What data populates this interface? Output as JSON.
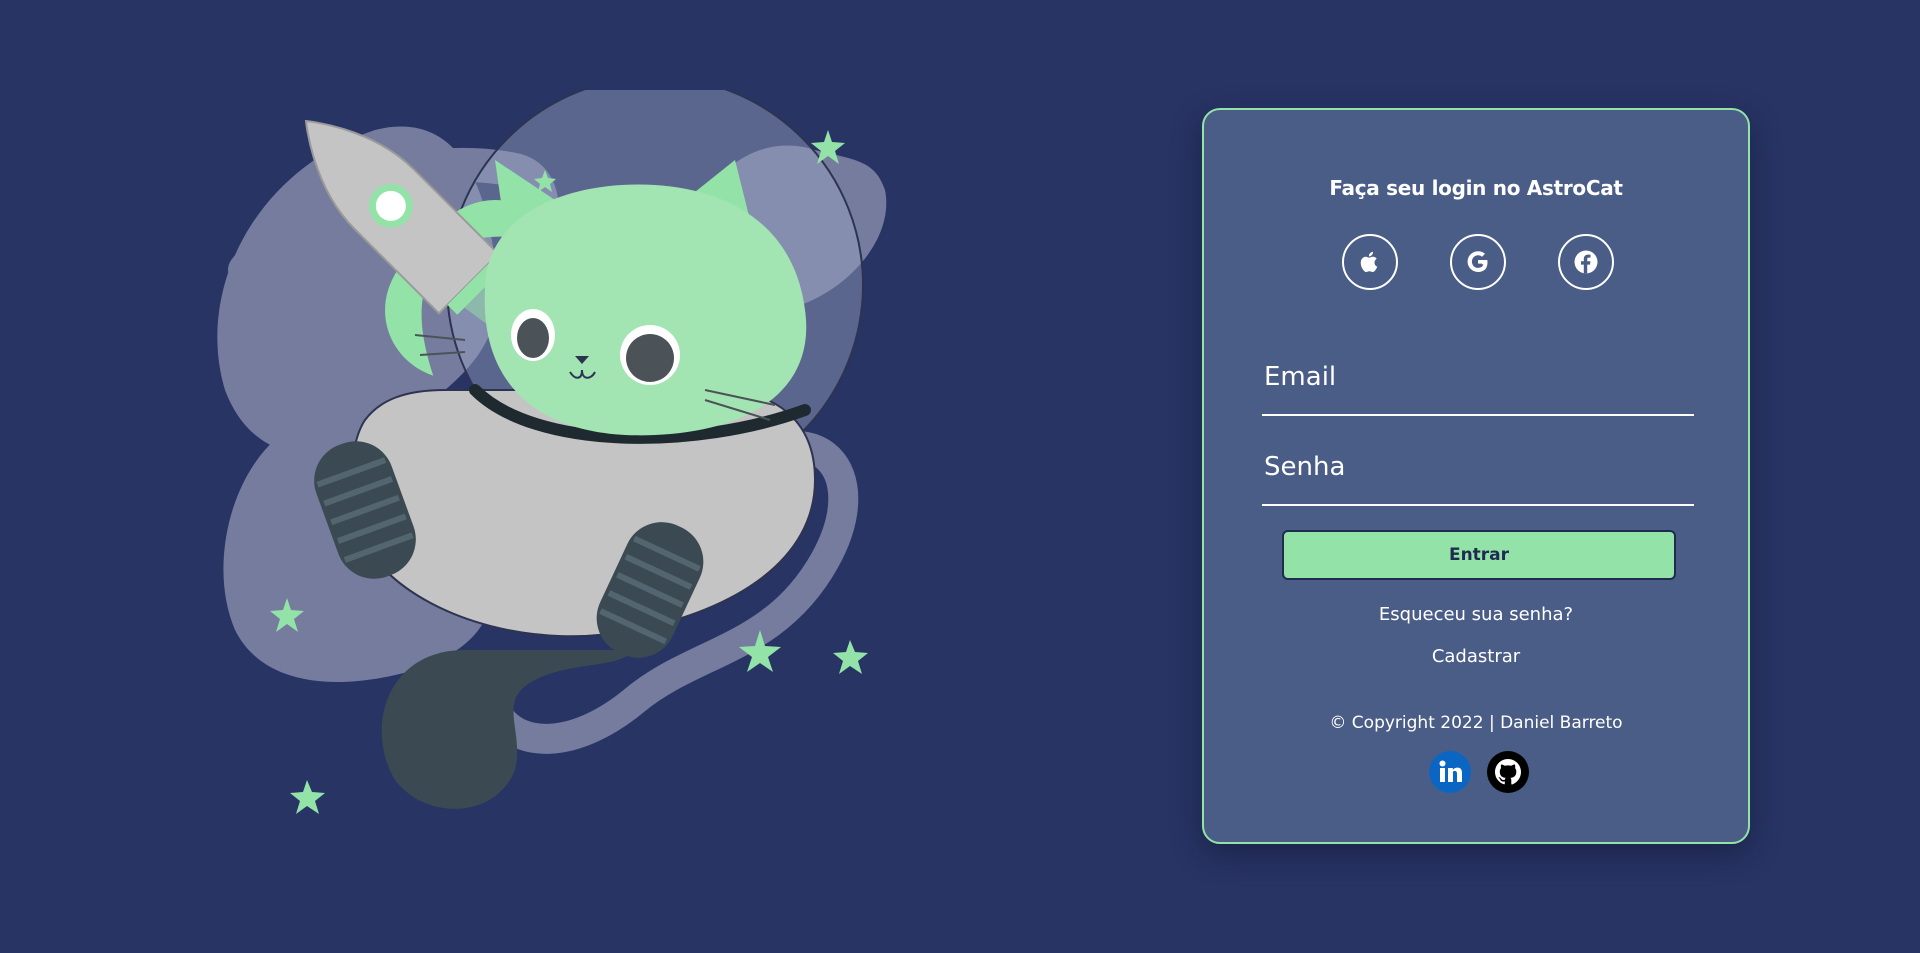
{
  "login": {
    "title": "Faça seu login no AstroCat",
    "social": [
      {
        "name": "apple-icon"
      },
      {
        "name": "google-icon"
      },
      {
        "name": "facebook-icon"
      }
    ],
    "email_placeholder": "Email",
    "password_placeholder": "Senha",
    "submit_label": "Entrar",
    "forgot_label": "Esqueceu sua senha?",
    "register_label": "Cadastrar"
  },
  "footer": {
    "copyright": "© Copyright 2022 | Daniel Barreto",
    "icons": [
      "linkedin-icon",
      "github-icon"
    ]
  },
  "colors": {
    "background": "#283464",
    "card": "#4a5d87",
    "accent": "#93e3a9",
    "linkedin": "#0a66c2"
  }
}
